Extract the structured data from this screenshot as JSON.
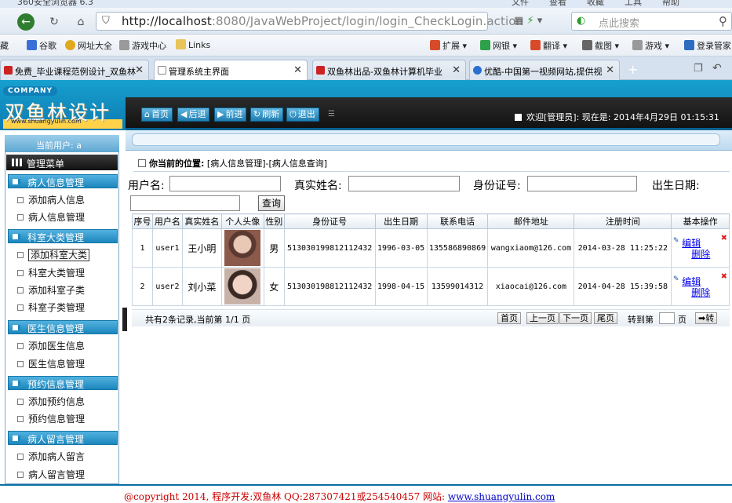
{
  "browser": {
    "window_title": "360安全浏览器 6.3",
    "window_menu": [
      "文件",
      "查看",
      "收藏",
      "工具",
      "帮助"
    ],
    "url_host": "http://localhost",
    "url_rest": ":8080/JavaWebProject/login/login_CheckLogin.action",
    "search_placeholder": "点此搜索",
    "favorites": [
      {
        "label": "藏",
        "icon": "bookmark-icon",
        "color": "#d8a13a"
      },
      {
        "label": "谷歌",
        "icon": "google-icon",
        "color": "#3b6fd8"
      },
      {
        "label": "网址大全",
        "icon": "globe-icon",
        "color": "#e0a81c"
      },
      {
        "label": "游戏中心",
        "icon": "gamepad-icon",
        "color": "#7a7a7a"
      },
      {
        "label": "Links",
        "icon": "folder-icon",
        "color": "#e8c45a"
      }
    ],
    "tools": [
      {
        "label": "扩展",
        "icon": "extension-icon",
        "color": "#d84b2a"
      },
      {
        "label": "网银",
        "icon": "bank-shield-icon",
        "color": "#2ea04a"
      },
      {
        "label": "翻译",
        "icon": "translate-icon",
        "color": "#d84b2a"
      },
      {
        "label": "截图",
        "icon": "screenshot-icon",
        "color": "#555555"
      },
      {
        "label": "游戏",
        "icon": "game-icon",
        "color": "#888888"
      },
      {
        "label": "登录管家",
        "icon": "login-manager-icon",
        "color": "#2d6cc0"
      }
    ],
    "tabs": [
      {
        "label": "免费_毕业课程范例设计_双鱼林",
        "icon_color": "#cc2222",
        "active": false
      },
      {
        "label": "管理系统主界面",
        "icon_color": "#ffffff",
        "active": true
      },
      {
        "label": "双鱼林出品-双鱼林计算机毕业",
        "icon_color": "#cc2222",
        "active": false
      },
      {
        "label": "优酷-中国第一视频网站,提供视",
        "icon_color": "#2a6fd0",
        "active": false
      }
    ]
  },
  "header": {
    "company_badge": "COMPANY",
    "logo_text": "双鱼林设计",
    "logo_url": "www.shuangyulin.com",
    "buttons": [
      {
        "label": "首页",
        "icon": "⌂"
      },
      {
        "label": "后退",
        "icon": "◀"
      },
      {
        "label": "前进",
        "icon": "▶"
      },
      {
        "label": "刷新",
        "icon": "↻"
      },
      {
        "label": "退出",
        "icon": "⏻"
      }
    ],
    "welcome": "欢迎[管理员]:  现在是: 2014年4月29日 01:15:31"
  },
  "sidebar": {
    "current_user": "当前用户: a",
    "menu_title": "管理菜单",
    "groups": [
      {
        "title": "病人信息管理",
        "items": [
          "添加病人信息",
          "病人信息管理"
        ]
      },
      {
        "title": "科室大类管理",
        "items": [
          "添加科室大类",
          "科室大类管理",
          "添加科室子类",
          "科室子类管理"
        ]
      },
      {
        "title": "医生信息管理",
        "items": [
          "添加医生信息",
          "医生信息管理"
        ]
      },
      {
        "title": "预约信息管理",
        "items": [
          "添加预约信息",
          "预约信息管理"
        ]
      },
      {
        "title": "病人留言管理",
        "items": [
          "添加病人留言",
          "病人留言管理"
        ]
      }
    ]
  },
  "content": {
    "location_label": "你当前的位置:",
    "location_path": "[病人信息管理]-[病人信息查询]",
    "search": {
      "username_label": "用户名:",
      "realname_label": "真实姓名:",
      "idcard_label": "身份证号:",
      "birthday_label": "出生日期:",
      "query_button": "查询"
    },
    "table": {
      "columns": [
        "序号",
        "用户名",
        "真实姓名",
        "个人头像",
        "性别",
        "身份证号",
        "出生日期",
        "联系电话",
        "邮件地址",
        "注册时间",
        "基本操作"
      ],
      "rows": [
        {
          "no": "1",
          "username": "user1",
          "realname": "王小明",
          "gender": "男",
          "idcard": "513030199812112432",
          "birthday": "1996-03-05",
          "phone": "135586890869",
          "email": "wangxiaom@126.com",
          "regtime": "2014-03-28 11:25:22",
          "edit": "编辑",
          "delete": "删除"
        },
        {
          "no": "2",
          "username": "user2",
          "realname": "刘小菜",
          "gender": "女",
          "idcard": "513030198812112432",
          "birthday": "1998-04-15",
          "phone": "13599014312",
          "email": "xiaocai@126.com",
          "regtime": "2014-04-28 15:39:58",
          "edit": "编辑",
          "delete": "删除"
        }
      ]
    },
    "pager": {
      "summary": "共有2条记录,当前第 1/1 页",
      "first": "首页",
      "prev": "上一页",
      "next": "下一页",
      "last": "尾页",
      "goto_label": "转到第",
      "page_suffix": "页",
      "go": "转"
    }
  },
  "footer": {
    "text": "@copyright 2014, 程序开发:双鱼林  QQ:287307421或254540457  网站: ",
    "site": "www.shuangyulin.com"
  }
}
